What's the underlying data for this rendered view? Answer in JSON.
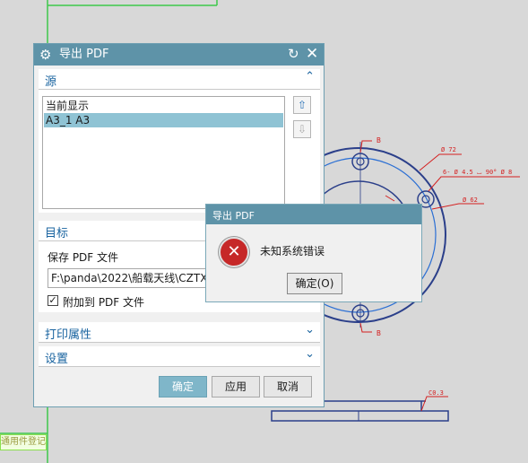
{
  "main_dialog": {
    "title": "导出 PDF",
    "source_section": {
      "label": "源",
      "items": [
        "当前显示",
        "A3_1  A3"
      ],
      "selected_index": 1
    },
    "target_section": {
      "label": "目标",
      "save_label": "保存 PDF 文件",
      "path_value": "F:\\panda\\2022\\船载天线\\CZTX",
      "append_checked": true,
      "append_label": "附加到 PDF 文件"
    },
    "print_props_label": "打印属性",
    "settings_label": "设置",
    "buttons": {
      "ok": "确定",
      "apply": "应用",
      "cancel": "取消"
    }
  },
  "error_dialog": {
    "title": "导出 PDF",
    "message": "未知系统错误",
    "ok": "确定(O)"
  },
  "cad": {
    "labels": [
      "B",
      "B",
      "Ø 72",
      "6- Ø 4.5 ⌴ 90° Ø 8",
      "Ø 62",
      "C0.3",
      "通用件登记"
    ]
  },
  "colors": {
    "title_bar": "#5e93a8",
    "selection": "#8fc3d4",
    "primary_button": "#7fb6c9",
    "drawing_blue": "#2b3f8a",
    "dimension_red": "#d42020",
    "grid_green": "#3ec84a"
  }
}
